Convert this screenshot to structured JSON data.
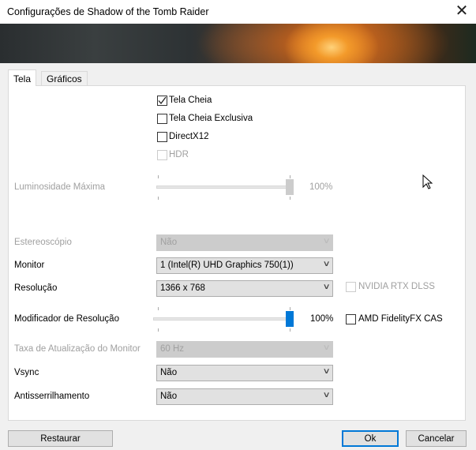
{
  "window": {
    "title": "Configurações de Shadow of the Tomb Raider",
    "close_icon": "close-icon"
  },
  "tabs": [
    {
      "label": "Tela",
      "active": true
    },
    {
      "label": "Gráficos",
      "active": false
    }
  ],
  "checkboxes": [
    {
      "label": "Tela Cheia",
      "checked": true,
      "enabled": true
    },
    {
      "label": "Tela Cheia Exclusiva",
      "checked": false,
      "enabled": true
    },
    {
      "label": "DirectX12",
      "checked": false,
      "enabled": true
    },
    {
      "label": "HDR",
      "checked": false,
      "enabled": false
    }
  ],
  "brightness": {
    "label": "Luminosidade Máxima",
    "value_text": "100%",
    "value": 100,
    "enabled": false
  },
  "stereo": {
    "label": "Estereoscópio",
    "value": "Não",
    "enabled": false
  },
  "monitor": {
    "label": "Monitor",
    "value": "1 (Intel(R) UHD Graphics 750(1))"
  },
  "resolution": {
    "label": "Resolução",
    "value": "1366 x 768"
  },
  "dlss": {
    "label": "NVIDIA RTX DLSS",
    "checked": false,
    "enabled": false
  },
  "res_modifier": {
    "label": "Modificador de Resolução",
    "value_text": "100%",
    "value": 100,
    "accent": "#0078d7"
  },
  "fidelityfx": {
    "label": "AMD FidelityFX CAS",
    "checked": false
  },
  "refresh": {
    "label": "Taxa de Atualização do Monitor",
    "value": "60 Hz",
    "enabled": false
  },
  "vsync": {
    "label": "Vsync",
    "value": "Não"
  },
  "antialiasing": {
    "label": "Antisserrilhamento",
    "value": "Não"
  },
  "buttons": {
    "restore": "Restaurar",
    "ok": "Ok",
    "cancel": "Cancelar"
  }
}
